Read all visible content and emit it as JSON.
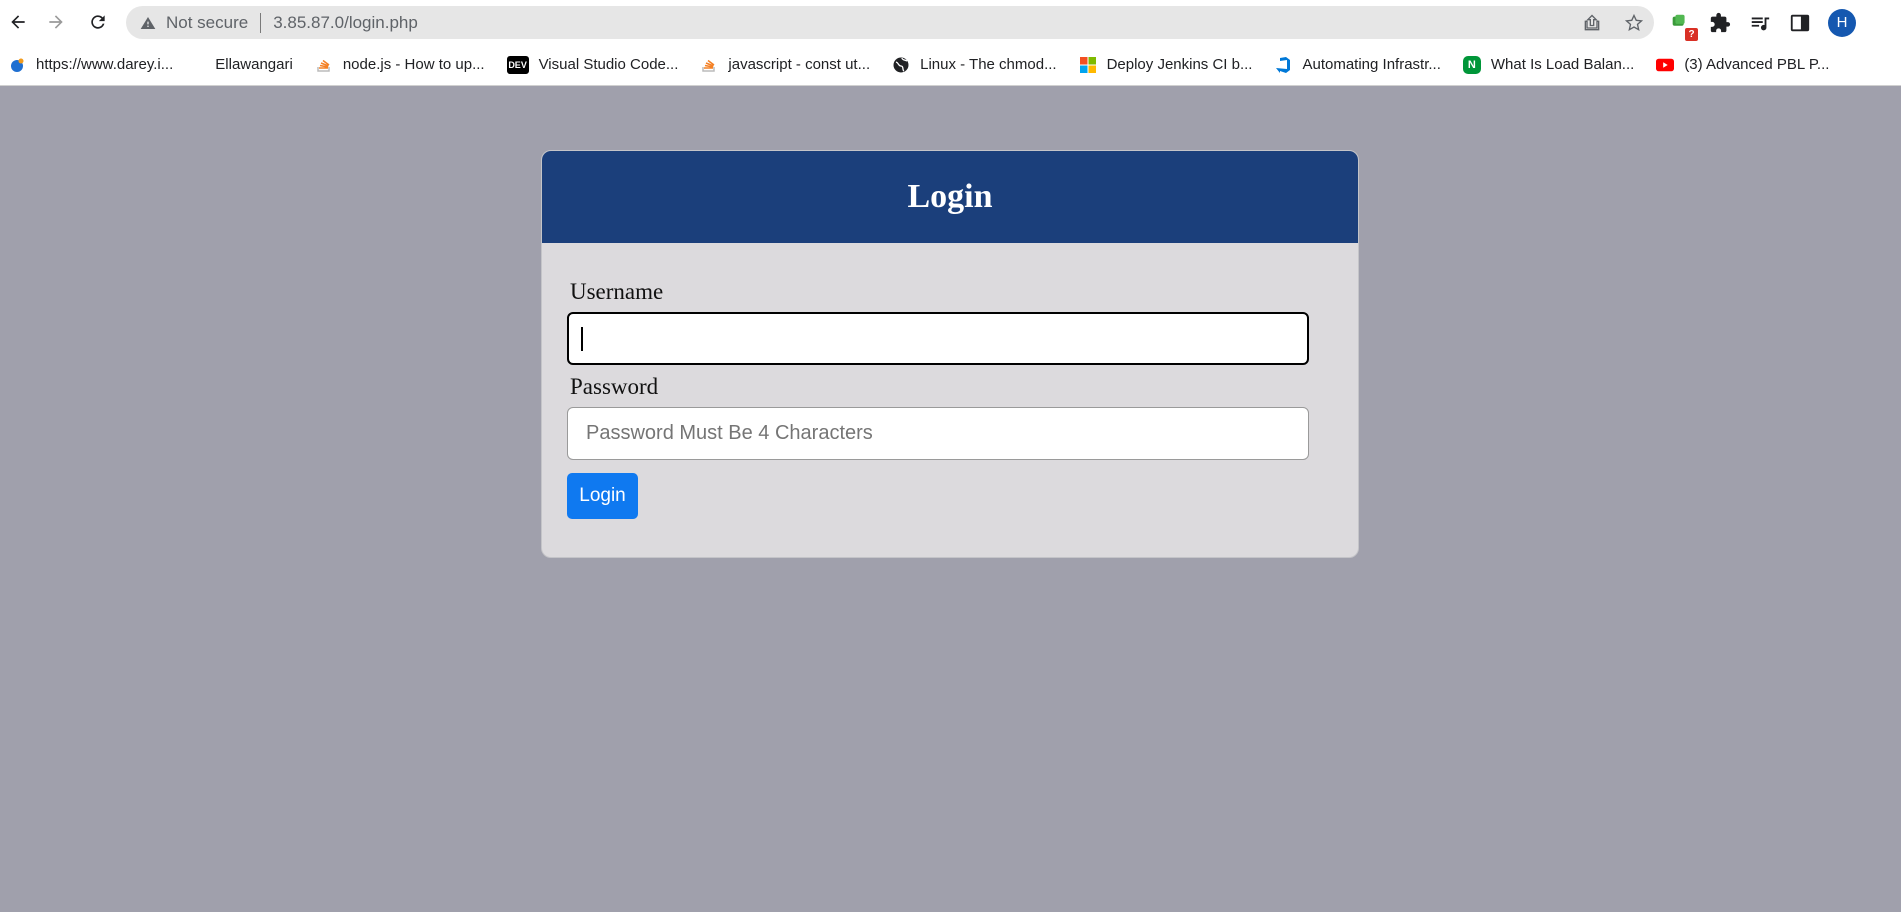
{
  "browser": {
    "security_label": "Not secure",
    "url": "3.85.87.0/login.php",
    "profile_initial": "H",
    "extension_badge": "?"
  },
  "bookmarks": [
    {
      "label": "https://www.darey.i...",
      "icon": "darey-icon"
    },
    {
      "label": "Ellawangari",
      "icon": "none"
    },
    {
      "label": "node.js - How to up...",
      "icon": "stackoverflow-icon"
    },
    {
      "label": "Visual Studio Code...",
      "icon": "dev-icon",
      "icon_text": "DEV"
    },
    {
      "label": "javascript - const ut...",
      "icon": "stackoverflow-icon"
    },
    {
      "label": "Linux - The chmod...",
      "icon": "globe-icon"
    },
    {
      "label": "Deploy Jenkins CI b...",
      "icon": "microsoft-icon"
    },
    {
      "label": "Automating Infrastr...",
      "icon": "azure-devops-icon"
    },
    {
      "label": "What Is Load Balan...",
      "icon": "nginx-icon",
      "icon_text": "N"
    },
    {
      "label": "(3) Advanced PBL P...",
      "icon": "youtube-icon"
    }
  ],
  "login": {
    "title": "Login",
    "username_label": "Username",
    "username_value": "",
    "password_label": "Password",
    "password_placeholder": "Password Must Be 4 Characters",
    "submit_label": "Login"
  },
  "colors": {
    "page_bg": "#a0a0ac",
    "card_header": "#1b3f7b",
    "card_body": "#dcdadd",
    "button": "#0f79f0"
  }
}
